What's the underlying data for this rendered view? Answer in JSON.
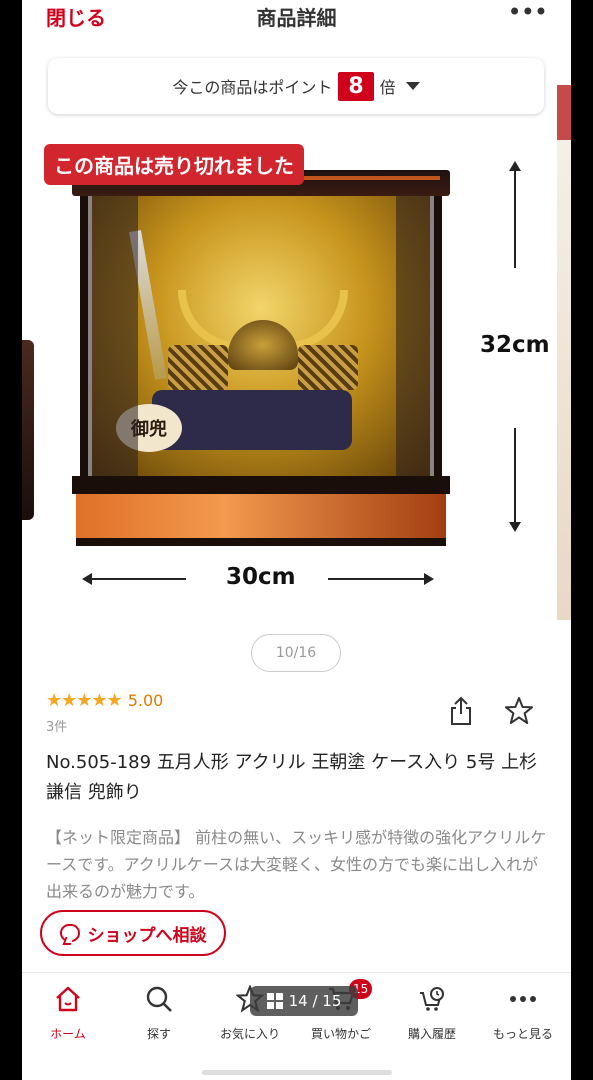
{
  "header": {
    "close_label": "閉じる",
    "title": "商品詳細",
    "more_label": "•••"
  },
  "points": {
    "prefix": "今この商品はポイント",
    "multiplier": "8",
    "suffix": "倍"
  },
  "image": {
    "soldout_label": "この商品は売り切れました",
    "height_label": "32cm",
    "width_label": "30cm",
    "tag_text": "御兜",
    "counter": "10/16"
  },
  "rating": {
    "stars": "★★★★★",
    "value": "5.00",
    "count": "3件"
  },
  "product": {
    "name": "No.505-189 五月人形 アクリル 王朝塗 ケース入り 5号 上杉謙信 兜飾り",
    "description": "【ネット限定商品】 前柱の無い、スッキリ感が特徴の強化アクリルケースです。アクリルケースは大変軽く、女性の方でも楽に出し入れが出来るのが魅力です。"
  },
  "consult": {
    "label": "ショップへ相談"
  },
  "nav": {
    "items": [
      {
        "label": "ホーム",
        "icon": "home-icon"
      },
      {
        "label": "探す",
        "icon": "search-icon"
      },
      {
        "label": "お気に入り",
        "icon": "star-icon"
      },
      {
        "label": "買い物かご",
        "icon": "cart-icon"
      },
      {
        "label": "購入履歴",
        "icon": "history-icon"
      },
      {
        "label": "もっと見る",
        "icon": "more-icon"
      }
    ],
    "cart_count": "15"
  },
  "page_indicator": "14 / 15",
  "colors": {
    "accent": "#d0021b",
    "star": "#f5a623"
  }
}
